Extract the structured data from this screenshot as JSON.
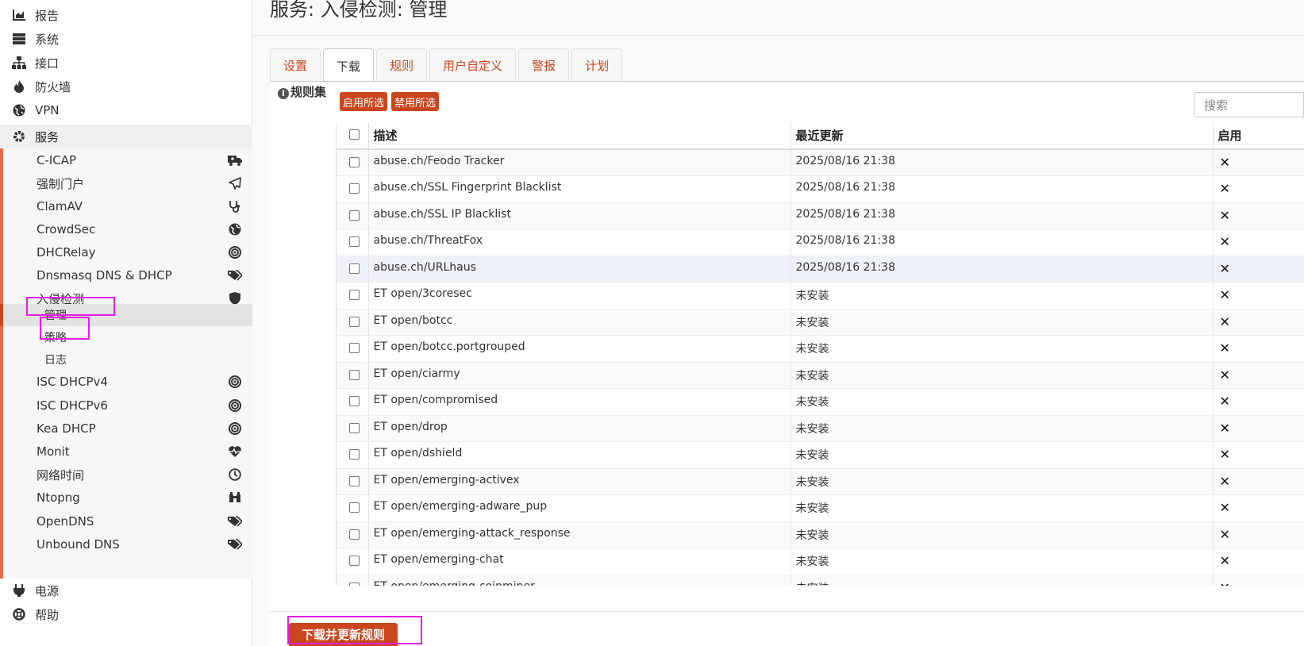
{
  "sidebar": {
    "top_items": [
      {
        "label": "报告",
        "icon": "chart-icon"
      },
      {
        "label": "系统",
        "icon": "server-icon"
      },
      {
        "label": "接口",
        "icon": "network-icon"
      },
      {
        "label": "防火墙",
        "icon": "fire-icon"
      },
      {
        "label": "VPN",
        "icon": "globe-icon"
      }
    ],
    "services": {
      "label": "服务",
      "items": [
        {
          "label": "C-ICAP",
          "icon": "truck-icon"
        },
        {
          "label": "强制门户",
          "icon": "paper-plane-icon"
        },
        {
          "label": "ClamAV",
          "icon": "stethoscope-icon"
        },
        {
          "label": "CrowdSec",
          "icon": "globe-icon"
        },
        {
          "label": "DHCRelay",
          "icon": "target-icon"
        },
        {
          "label": "Dnsmasq DNS & DHCP",
          "icon": "tags-icon"
        },
        {
          "label": "入侵检测",
          "icon": "shield-icon"
        }
      ],
      "ids_children": [
        {
          "label": "管理"
        },
        {
          "label": "策略"
        },
        {
          "label": "日志"
        }
      ],
      "items_after": [
        {
          "label": "ISC DHCPv4",
          "icon": "target-icon"
        },
        {
          "label": "ISC DHCPv6",
          "icon": "target-icon"
        },
        {
          "label": "Kea DHCP",
          "icon": "target-icon"
        },
        {
          "label": "Monit",
          "icon": "heartbeat-icon"
        },
        {
          "label": "网络时间",
          "icon": "clock-icon"
        },
        {
          "label": "Ntopng",
          "icon": "binoculars-icon"
        },
        {
          "label": "OpenDNS",
          "icon": "tags-icon"
        },
        {
          "label": "Unbound DNS",
          "icon": "tags-icon"
        }
      ]
    },
    "bottom_items": [
      {
        "label": "电源",
        "icon": "plug-icon"
      },
      {
        "label": "帮助",
        "icon": "lifebuoy-icon"
      }
    ]
  },
  "main": {
    "title": "服务: 入侵检测: 管理",
    "tabs": [
      {
        "label": "设置"
      },
      {
        "label": "下载"
      },
      {
        "label": "规则"
      },
      {
        "label": "用户自定义"
      },
      {
        "label": "警报"
      },
      {
        "label": "计划"
      }
    ],
    "panel_label": "规则集",
    "enable_selected": "启用所选",
    "disable_selected": "禁用所选",
    "search_placeholder": "搜索",
    "columns": {
      "description": "描述",
      "last_updated": "最近更新",
      "enabled": "启用"
    },
    "rows": [
      {
        "description": "abuse.ch/Feodo Tracker",
        "updated": "2025/08/16 21:38",
        "enabled": "✕"
      },
      {
        "description": "abuse.ch/SSL Fingerprint Blacklist",
        "updated": "2025/08/16 21:38",
        "enabled": "✕"
      },
      {
        "description": "abuse.ch/SSL IP Blacklist",
        "updated": "2025/08/16 21:38",
        "enabled": "✕"
      },
      {
        "description": "abuse.ch/ThreatFox",
        "updated": "2025/08/16 21:38",
        "enabled": "✕"
      },
      {
        "description": "abuse.ch/URLhaus",
        "updated": "2025/08/16 21:38",
        "enabled": "✕"
      },
      {
        "description": "ET open/3coresec",
        "updated": "未安装",
        "enabled": "✕"
      },
      {
        "description": "ET open/botcc",
        "updated": "未安装",
        "enabled": "✕"
      },
      {
        "description": "ET open/botcc.portgrouped",
        "updated": "未安装",
        "enabled": "✕"
      },
      {
        "description": "ET open/ciarmy",
        "updated": "未安装",
        "enabled": "✕"
      },
      {
        "description": "ET open/compromised",
        "updated": "未安装",
        "enabled": "✕"
      },
      {
        "description": "ET open/drop",
        "updated": "未安装",
        "enabled": "✕"
      },
      {
        "description": "ET open/dshield",
        "updated": "未安装",
        "enabled": "✕"
      },
      {
        "description": "ET open/emerging-activex",
        "updated": "未安装",
        "enabled": "✕"
      },
      {
        "description": "ET open/emerging-adware_pup",
        "updated": "未安装",
        "enabled": "✕"
      },
      {
        "description": "ET open/emerging-attack_response",
        "updated": "未安装",
        "enabled": "✕"
      },
      {
        "description": "ET open/emerging-chat",
        "updated": "未安装",
        "enabled": "✕"
      },
      {
        "description": "ET open/emerging-coinminer",
        "updated": "未安装",
        "enabled": "✕"
      }
    ],
    "download_button": "下载并更新规则"
  }
}
